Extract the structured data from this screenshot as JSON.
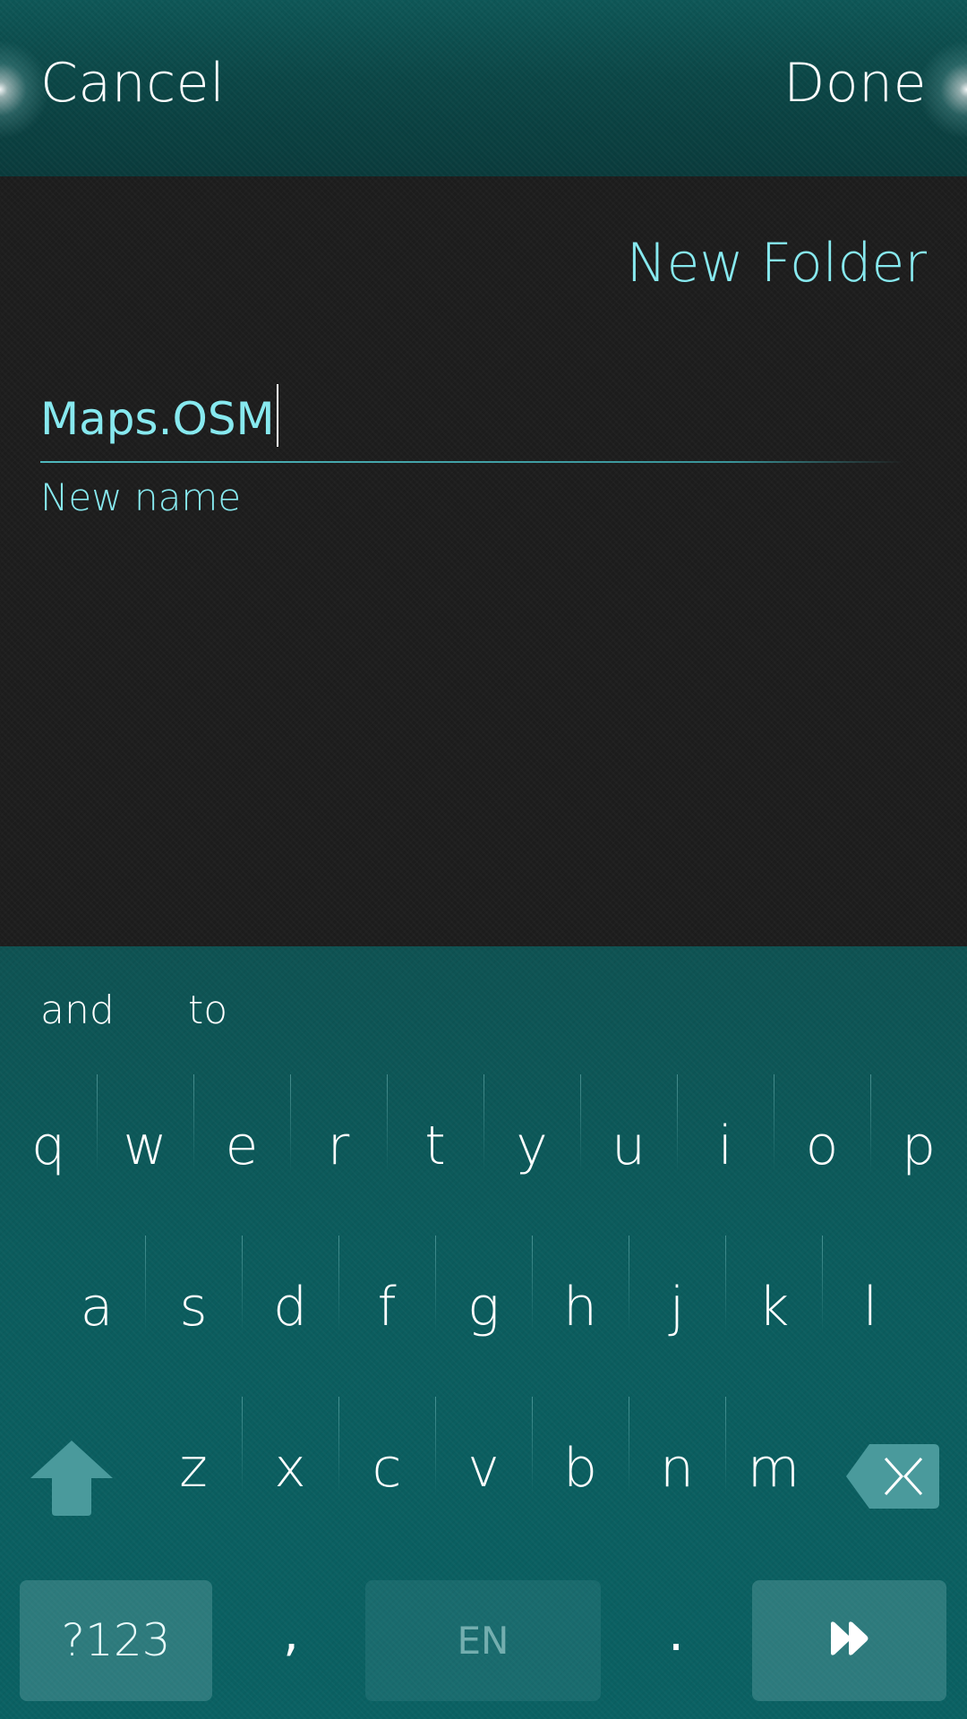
{
  "header": {
    "cancel_label": "Cancel",
    "done_label": "Done"
  },
  "dialog": {
    "title": "New Folder",
    "name_field": {
      "value": "Maps.OSM",
      "label": "New name"
    }
  },
  "keyboard": {
    "suggestions": [
      "and",
      "to"
    ],
    "rows": [
      [
        "q",
        "w",
        "e",
        "r",
        "t",
        "y",
        "u",
        "i",
        "o",
        "p"
      ],
      [
        "a",
        "s",
        "d",
        "f",
        "g",
        "h",
        "j",
        "k",
        "l"
      ],
      [
        "z",
        "x",
        "c",
        "v",
        "b",
        "n",
        "m"
      ]
    ],
    "symbols_label": "?123",
    "comma_label": ",",
    "space_label": "EN",
    "period_label": ".",
    "shift_icon": "shift-arrow-icon",
    "backspace_icon": "backspace-icon",
    "enter_icon": "fast-forward-icon"
  },
  "colors": {
    "accent": "#87e9ef",
    "header_bg": "#0b4747",
    "body_bg": "#1c1c1c",
    "keyboard_bg": "#0b5c5d"
  }
}
